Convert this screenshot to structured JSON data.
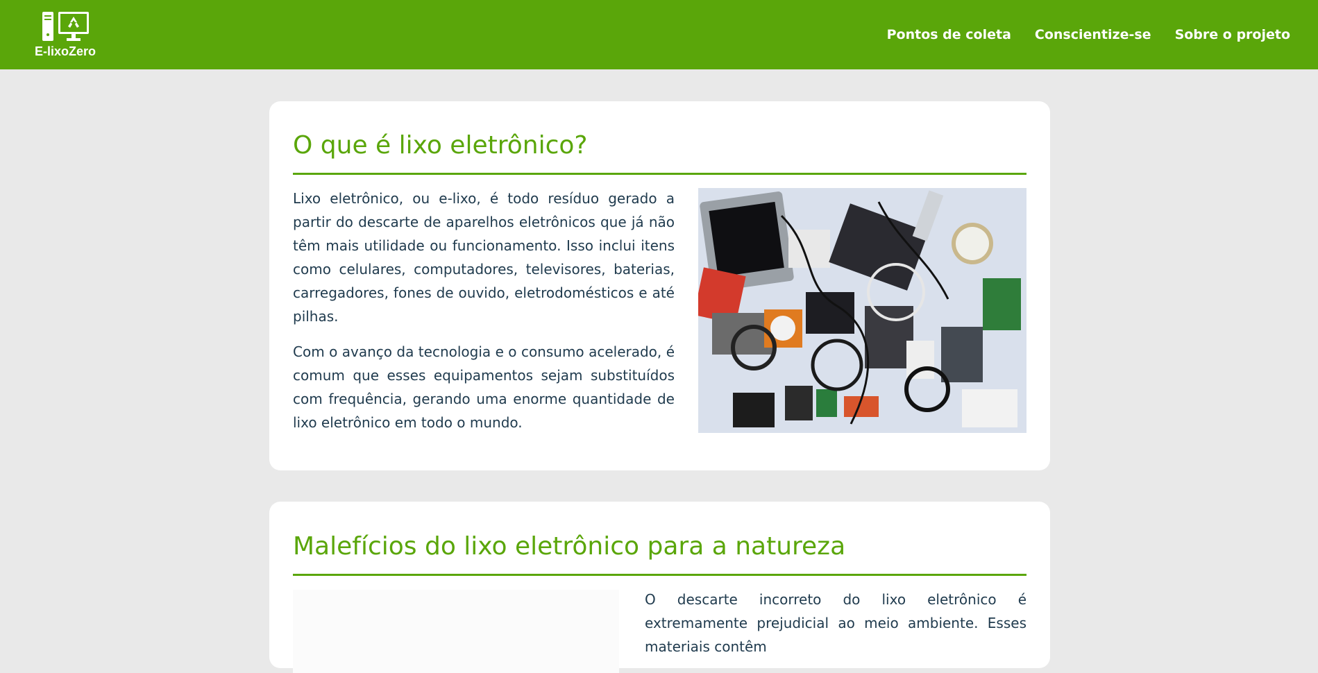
{
  "header": {
    "brand": "E-lixoZero",
    "logo_icon": "computer-recycle-icon",
    "nav": [
      "Pontos de coleta",
      "Conscientize-se",
      "Sobre o projeto"
    ],
    "colors": {
      "brand_green": "#5aa60a",
      "background": "#e9e9e9",
      "text": "#1f3a4d"
    }
  },
  "section1": {
    "title": "O que é lixo eletrônico?",
    "paragraphs": [
      "Lixo eletrônico, ou e-lixo, é todo resíduo gerado a partir do descarte de aparelhos eletrônicos que já não têm mais utilidade ou funcionamento. Isso inclui itens como celulares, computadores, televisores, baterias, carregadores, fones de ouvido, eletrodomésticos e até pilhas.",
      "Com o avanço da tecnologia e o consumo acelerado, é comum que esses equipamentos sejam substituídos com frequência, gerando uma enorme quantidade de lixo eletrônico em todo o mundo."
    ]
  },
  "section2": {
    "title": "Malefícios do lixo eletrônico para a natureza",
    "paragraphs": [
      "O descarte incorreto do lixo eletrônico é extremamente prejudicial ao meio ambiente. Esses materiais contêm"
    ]
  }
}
